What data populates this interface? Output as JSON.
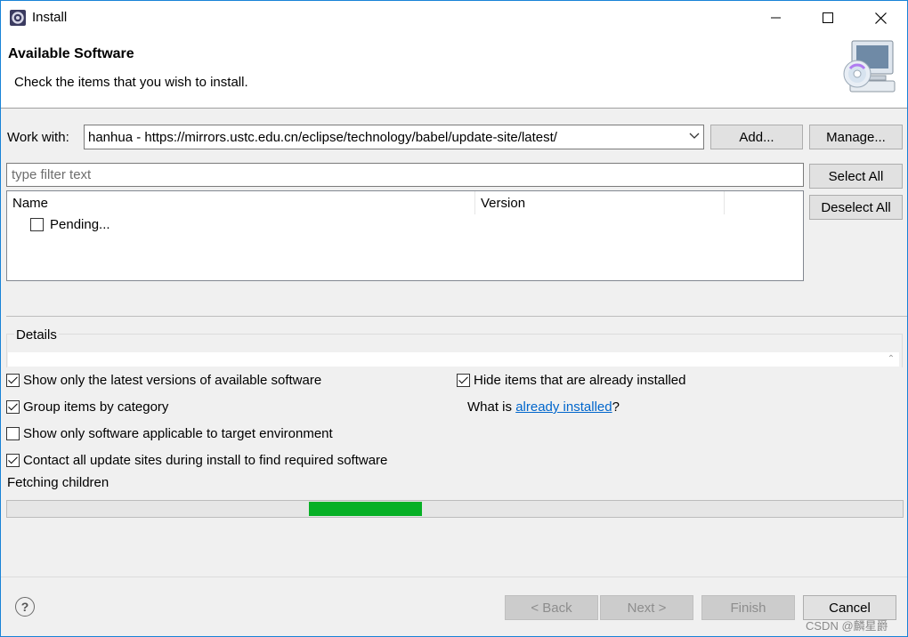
{
  "window": {
    "title": "Install"
  },
  "header": {
    "title": "Available Software",
    "subtitle": "Check the items that you wish to install."
  },
  "work_with": {
    "label": "Work with:",
    "value": "hanhua - https://mirrors.ustc.edu.cn/eclipse/technology/babel/update-site/latest/",
    "add_label": "Add...",
    "manage_label": "Manage..."
  },
  "filter": {
    "placeholder": "type filter text"
  },
  "tree": {
    "columns": [
      "Name",
      "Version"
    ],
    "rows": [
      {
        "label": "Pending...",
        "checked": false
      }
    ]
  },
  "side_buttons": {
    "select_all": "Select All",
    "deselect_all": "Deselect All"
  },
  "details": {
    "label": "Details"
  },
  "options": {
    "latest_versions": {
      "label": "Show only the latest versions of available software",
      "checked": true
    },
    "group_by_category": {
      "label": "Group items by category",
      "checked": true
    },
    "target_env": {
      "label": "Show only software applicable to target environment",
      "checked": false
    },
    "contact_sites": {
      "label": "Contact all update sites during install to find required software",
      "checked": true
    },
    "hide_installed": {
      "label": "Hide items that are already installed",
      "checked": true
    },
    "what_is_prefix": "What is ",
    "what_is_link": "already installed",
    "what_is_suffix": "?"
  },
  "status": {
    "text": "Fetching children",
    "progress": {
      "start_fraction": 0.337,
      "end_fraction": 0.463,
      "color": "#06b025"
    }
  },
  "footer": {
    "help_glyph": "?",
    "back_label": "< Back",
    "next_label": "Next >",
    "finish_label": "Finish",
    "cancel_label": "Cancel"
  },
  "watermark": "CSDN @麟星爵",
  "icons": {
    "app": "eclipse-gear-icon",
    "minimize": "minimize-icon",
    "maximize": "maximize-icon",
    "close": "close-icon",
    "header": "computer-cd-icon",
    "dropdown": "chevron-down-icon",
    "help": "help-icon"
  }
}
